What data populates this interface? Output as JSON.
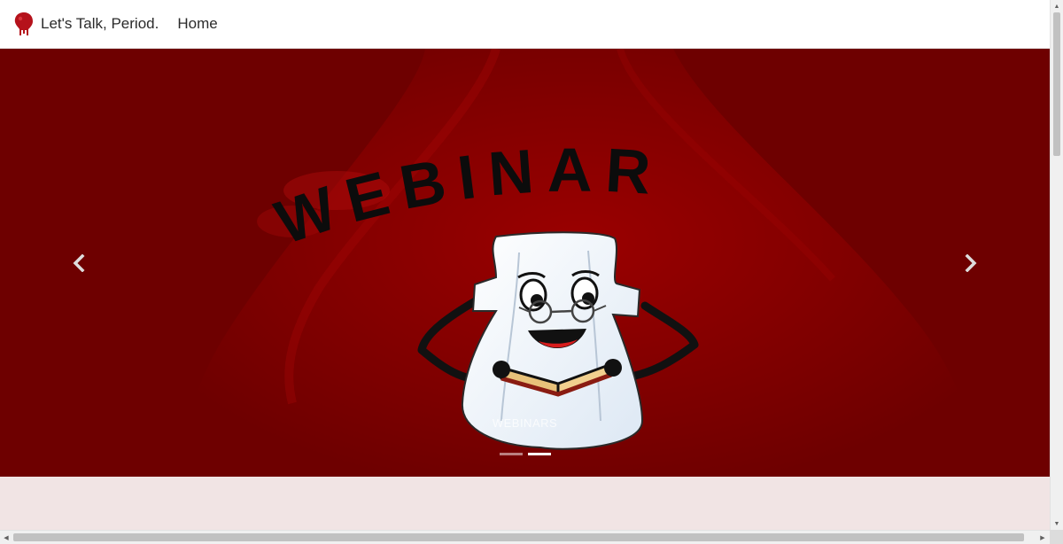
{
  "navbar": {
    "brand_text": "Let's Talk, Period.",
    "links": [
      {
        "label": "Home"
      }
    ]
  },
  "carousel": {
    "slide_heading": "WEBINAR",
    "caption": "WEBINARS",
    "indicator_count": 2,
    "active_indicator": 2,
    "prev_icon": "chevron-left-icon",
    "next_icon": "chevron-right-icon"
  },
  "colors": {
    "hero_background": "#6e0000",
    "page_background": "#f1e4e4",
    "brand_red": "#b5121b",
    "navbar_background": "#ffffff"
  }
}
